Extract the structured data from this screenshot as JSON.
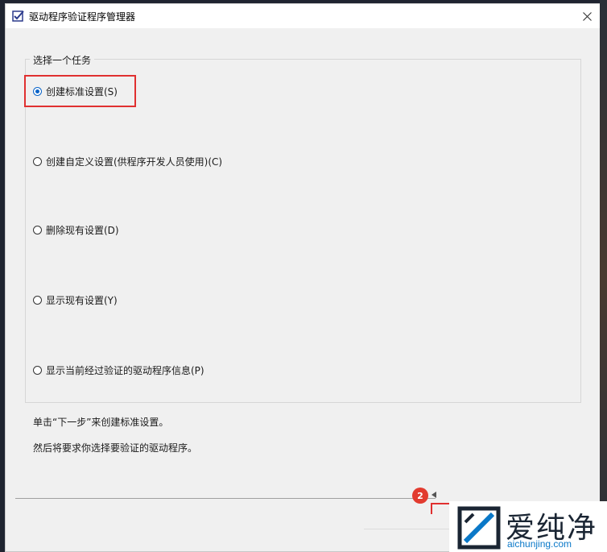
{
  "window": {
    "title": "驱动程序验证程序管理器",
    "close_symbol": "✕"
  },
  "group": {
    "legend": "选择一个任务",
    "options": [
      {
        "label": "创建标准设置(S)",
        "checked": true
      },
      {
        "label": "创建自定义设置(供程序开发人员使用)(C)",
        "checked": false
      },
      {
        "label": "删除现有设置(D)",
        "checked": false
      },
      {
        "label": "显示现有设置(Y)",
        "checked": false
      },
      {
        "label": "显示当前经过验证的驱动程序信息(P)",
        "checked": false
      }
    ]
  },
  "description": {
    "line1": "单击“下一步”来创建标准设置。",
    "line2": "然后将要求你选择要验证的驱动程序。"
  },
  "annotation": {
    "step_badge": "2"
  },
  "watermark": {
    "cn": "爱纯净",
    "en": "aichunjing.com"
  },
  "colors": {
    "accent": "#0a64c8",
    "highlight": "#e03030",
    "badge": "#e23b2f"
  }
}
